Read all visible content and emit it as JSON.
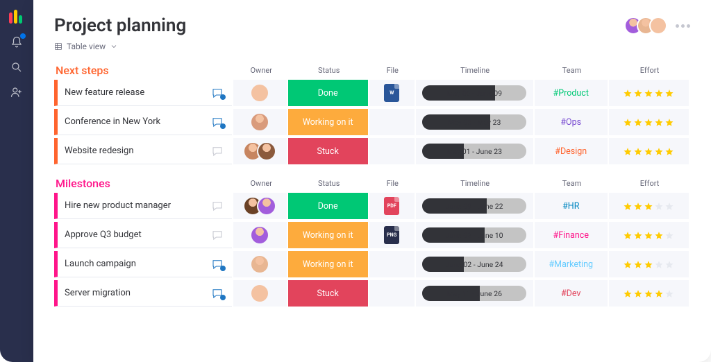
{
  "board_title": "Project planning",
  "view_label": "Table view",
  "columns": {
    "owner": "Owner",
    "status": "Status",
    "file": "File",
    "timeline": "Timeline",
    "team": "Team",
    "effort": "Effort"
  },
  "status_colors": {
    "Done": "#00c875",
    "Working on it": "#fdab3d",
    "Stuck": "#e2445c"
  },
  "team_colors": {
    "#Product": "#00c875",
    "#Ops": "#784bd1",
    "#Design": "#ff642e",
    "#HR": "#0086c0",
    "#Finance": "#ff158a",
    "#Marketing": "#66ccff",
    "#Dev": "#e2445c"
  },
  "groups": [
    {
      "title": "Next steps",
      "color": "orange",
      "rows": [
        {
          "name": "New feature release",
          "chat_active": true,
          "owners": 1,
          "status": "Done",
          "file": "word",
          "file_label": "W",
          "timeline": "May 08 - June 09",
          "fill_pct": 70,
          "team": "#Product",
          "effort": 5
        },
        {
          "name": "Conference in New York",
          "chat_active": true,
          "owners": 1,
          "status": "Working on it",
          "file": null,
          "file_label": "",
          "timeline": "May 05 - May 23",
          "fill_pct": 65,
          "team": "#Ops",
          "effort": 5
        },
        {
          "name": "Website redesign",
          "chat_active": false,
          "owners": 2,
          "status": "Stuck",
          "file": null,
          "file_label": "",
          "timeline": "May 01 - June 23",
          "fill_pct": 40,
          "team": "#Design",
          "effort": 5
        }
      ]
    },
    {
      "title": "Milestones",
      "color": "pink",
      "rows": [
        {
          "name": "Hire new product manager",
          "chat_active": false,
          "owners": 2,
          "status": "Done",
          "file": "pdf",
          "file_label": "PDF",
          "timeline": "June 09 - June 22",
          "fill_pct": 62,
          "team": "#HR",
          "effort": 3
        },
        {
          "name": "Approve Q3 budget",
          "chat_active": false,
          "owners": 1,
          "status": "Working on it",
          "file": "png",
          "file_label": "PNG",
          "timeline": "June 02 - June 10",
          "fill_pct": 60,
          "team": "#Finance",
          "effort": 4
        },
        {
          "name": "Launch campaign",
          "chat_active": true,
          "owners": 1,
          "status": "Working on it",
          "file": null,
          "file_label": "",
          "timeline": "June 02  - June 24",
          "fill_pct": 40,
          "team": "#Marketing",
          "effort": 3
        },
        {
          "name": "Server migration",
          "chat_active": true,
          "owners": 1,
          "status": "Stuck",
          "file": null,
          "file_label": "",
          "timeline": "May 11 - June 26",
          "fill_pct": 55,
          "team": "#Dev",
          "effort": 4
        }
      ]
    }
  ],
  "avatar_palette": [
    "#a25ddc",
    "#e8b692",
    "#f4c2a1",
    "#d99b7c",
    "#c78560",
    "#8b5a3c",
    "#6b4226"
  ]
}
